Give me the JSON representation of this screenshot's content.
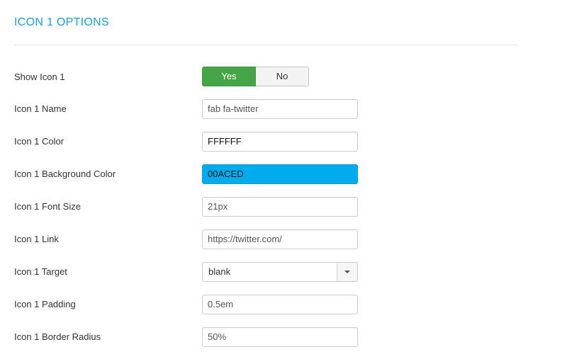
{
  "section": {
    "title": "ICON 1 OPTIONS"
  },
  "show_icon": {
    "label": "Show Icon 1",
    "yes_label": "Yes",
    "no_label": "No",
    "selected": "Yes"
  },
  "fields": {
    "name": {
      "label": "Icon 1 Name",
      "value": "fab fa-twitter"
    },
    "color": {
      "label": "Icon 1 Color",
      "value": "FFFFFF"
    },
    "background_color": {
      "label": "Icon 1 Background Color",
      "value": "00ACED",
      "swatch": "#00aced"
    },
    "font_size": {
      "label": "Icon 1 Font Size",
      "value": "21px"
    },
    "link": {
      "label": "Icon 1 Link",
      "value": "https://twitter.com/"
    },
    "target": {
      "label": "Icon 1 Target",
      "value": "blank",
      "icon": "chevron-down-icon"
    },
    "padding": {
      "label": "Icon 1 Padding",
      "value": "0.5em"
    },
    "border_radius": {
      "label": "Icon 1 Border Radius",
      "value": "50%"
    }
  },
  "colors": {
    "accent": "#1a9be0",
    "toggle_yes": "#46a546",
    "background_swatch": "#00aced"
  }
}
